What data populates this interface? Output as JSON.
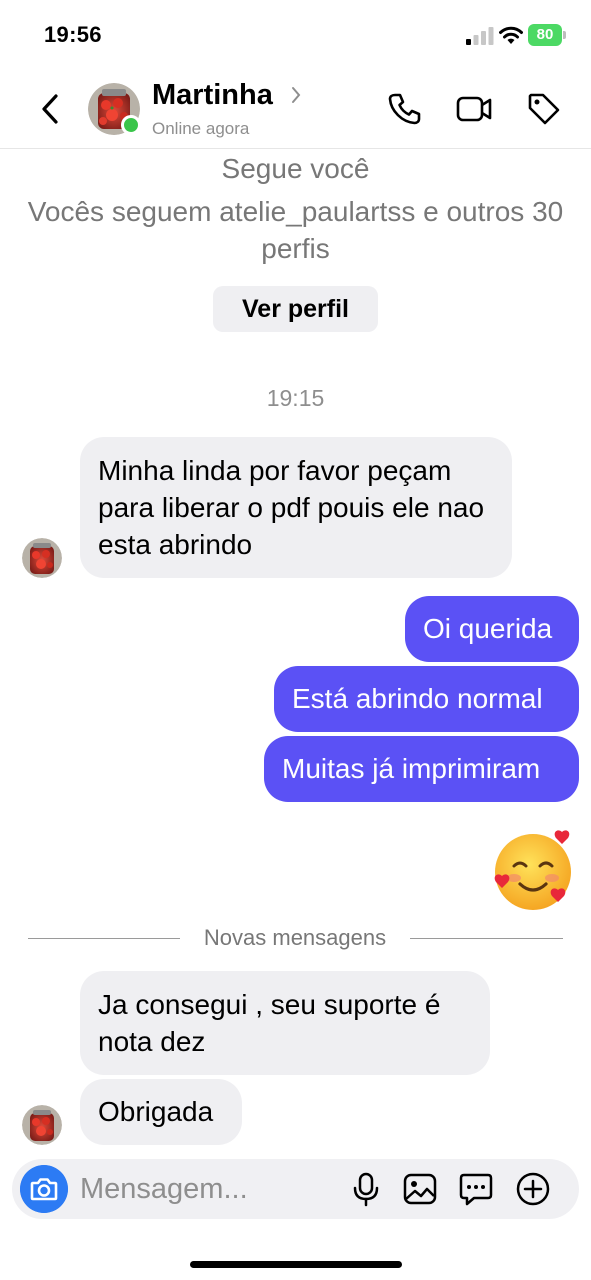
{
  "status_bar": {
    "time": "19:56",
    "battery": "80",
    "battery_color": "#4cd964",
    "icons": [
      "signal-icon",
      "wifi-icon",
      "battery-icon"
    ]
  },
  "header": {
    "back_icon": "chevron-left-icon",
    "name": "Martinha",
    "status": "Online agora",
    "online_color": "#3ac54a",
    "actions": [
      "phone-icon",
      "video-icon",
      "tag-icon"
    ]
  },
  "profile": {
    "follows_you": "Segue você",
    "mutuals": "Vocês seguem atelie_paulartss e outros 30 perfis",
    "view_profile": "Ver perfil"
  },
  "thread": {
    "timestamp": "19:15",
    "incoming_1": "Minha linda  por favor peçam para liberar o pdf pouis ele nao esta abrindo",
    "outgoing": [
      "Oi querida",
      "Está abrindo normal",
      "Muitas já imprimiram"
    ],
    "outgoing_color": "#5b51f5",
    "emoji": "smiling-face-with-hearts",
    "new_messages_label": "Novas mensagens",
    "incoming_2": "Ja consegui , seu suporte é nota dez",
    "incoming_3": "Obrigada"
  },
  "composer": {
    "placeholder": "Mensagem...",
    "icons": [
      "camera-icon",
      "microphone-icon",
      "image-icon",
      "sticker-icon",
      "plus-icon"
    ]
  }
}
